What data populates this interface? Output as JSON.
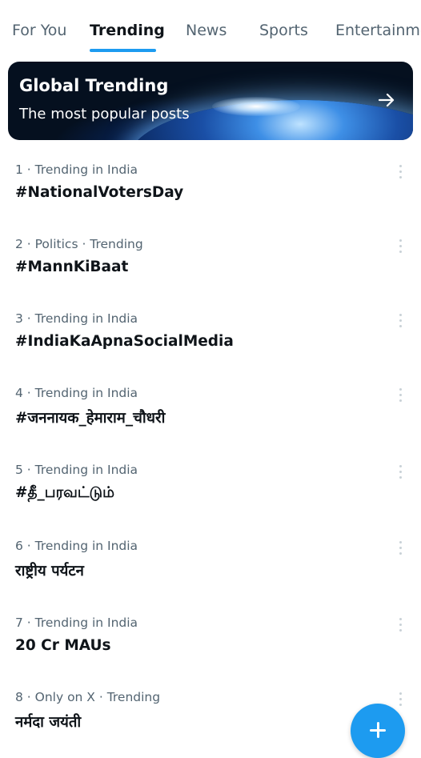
{
  "tabs": [
    {
      "label": "For You",
      "active": false
    },
    {
      "label": "Trending",
      "active": true
    },
    {
      "label": "News",
      "active": false
    },
    {
      "label": "Sports",
      "active": false
    },
    {
      "label": "Entertainme",
      "active": false
    }
  ],
  "banner": {
    "title": "Global Trending",
    "subtitle": "The most popular posts",
    "arrow_icon": "arrow-right-icon"
  },
  "trends": [
    {
      "meta": "1 · Trending in India",
      "name": "#NationalVotersDay"
    },
    {
      "meta": "2 · Politics · Trending",
      "name": "#MannKiBaat"
    },
    {
      "meta": "3 · Trending in India",
      "name": "#IndiaKaApnaSocialMedia"
    },
    {
      "meta": "4 · Trending in India",
      "name": "#जननायक_हेमाराम_चौधरी"
    },
    {
      "meta": "5 · Trending in India",
      "name": "#தீ_பரவட்டும்"
    },
    {
      "meta": "6 · Trending in India",
      "name": "राष्ट्रीय पर्यटन"
    },
    {
      "meta": "7 · Trending in India",
      "name": "20 Cr MAUs"
    },
    {
      "meta": "8 · Only on X · Trending",
      "name": "नर्मदा जयंती"
    }
  ],
  "icons": {
    "more": "more-vertical-icon",
    "compose": "plus-icon"
  },
  "colors": {
    "accent": "#1d9bf0",
    "text_primary": "#0f1419",
    "text_secondary": "#536471"
  }
}
